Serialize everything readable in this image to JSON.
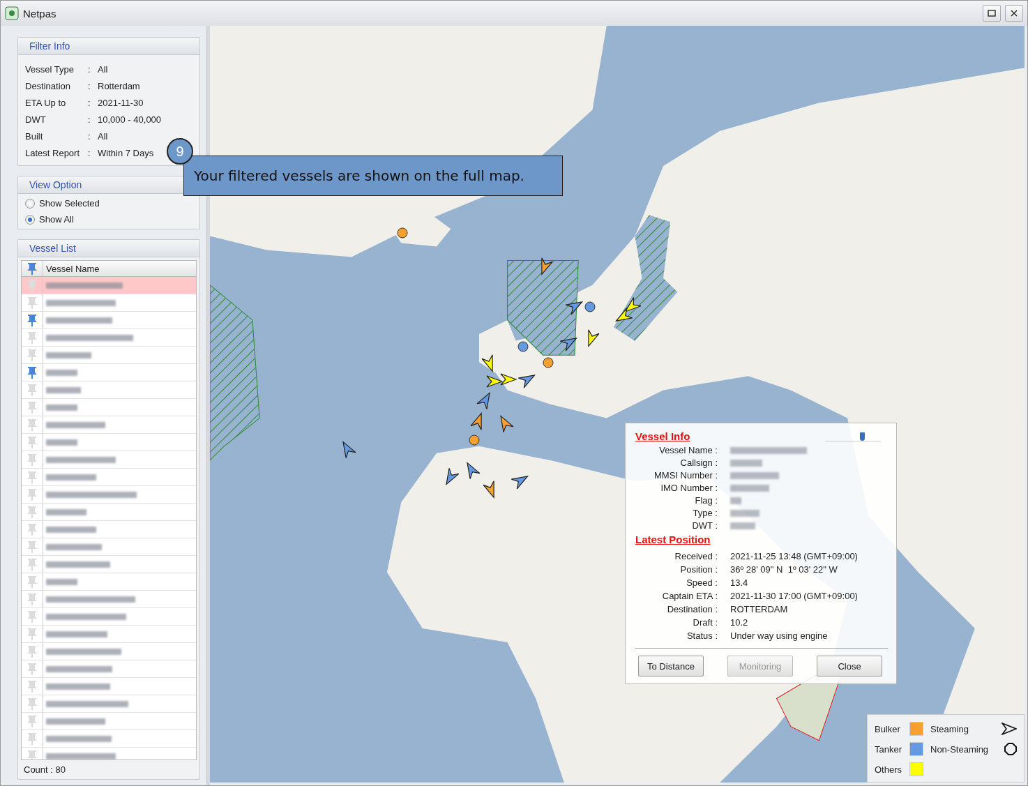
{
  "window": {
    "title": "Netpas"
  },
  "filter_info": {
    "title": "Filter Info",
    "rows": [
      {
        "label": "Vessel Type",
        "separator": ":",
        "value": "All"
      },
      {
        "label": "Destination",
        "separator": ":",
        "value": "Rotterdam"
      },
      {
        "label": "ETA Up to",
        "separator": ":",
        "value": "2021-11-30"
      },
      {
        "label": "DWT",
        "separator": ":",
        "value": "10,000 - 40,000"
      },
      {
        "label": "Built",
        "separator": ":",
        "value": "All"
      },
      {
        "label": "Latest Report",
        "separator": ":",
        "value": "Within 7 Days"
      }
    ]
  },
  "view_option": {
    "title": "View Option",
    "options": [
      {
        "label": "Show Selected",
        "selected": false
      },
      {
        "label": "Show All",
        "selected": true
      }
    ]
  },
  "vessel_list": {
    "title": "Vessel List",
    "column": "Vessel Name",
    "count": "Count : 80",
    "rows": [
      {
        "pinned": false,
        "selected": true
      },
      {
        "pinned": false,
        "selected": false
      },
      {
        "pinned": true,
        "selected": false
      },
      {
        "pinned": false,
        "selected": false
      },
      {
        "pinned": false,
        "selected": false
      },
      {
        "pinned": true,
        "selected": false
      },
      {
        "pinned": false,
        "selected": false
      },
      {
        "pinned": false,
        "selected": false
      },
      {
        "pinned": false,
        "selected": false
      },
      {
        "pinned": false,
        "selected": false
      },
      {
        "pinned": false,
        "selected": false
      },
      {
        "pinned": false,
        "selected": false
      },
      {
        "pinned": false,
        "selected": false
      },
      {
        "pinned": false,
        "selected": false
      },
      {
        "pinned": false,
        "selected": false
      },
      {
        "pinned": false,
        "selected": false
      },
      {
        "pinned": false,
        "selected": false
      },
      {
        "pinned": false,
        "selected": false
      },
      {
        "pinned": false,
        "selected": false
      },
      {
        "pinned": false,
        "selected": false
      },
      {
        "pinned": false,
        "selected": false
      },
      {
        "pinned": false,
        "selected": false
      },
      {
        "pinned": false,
        "selected": false
      },
      {
        "pinned": false,
        "selected": false
      },
      {
        "pinned": false,
        "selected": false
      },
      {
        "pinned": false,
        "selected": false
      },
      {
        "pinned": false,
        "selected": false
      },
      {
        "pinned": false,
        "selected": false
      }
    ]
  },
  "callout": {
    "step": "9",
    "text": "Your filtered vessels are shown on the full map."
  },
  "map": {
    "vessels": [
      {
        "color": "#f5a030",
        "steaming": false
      },
      {
        "color": "#f5a030",
        "steaming": true
      },
      {
        "color": "#6699dd",
        "steaming": false
      },
      {
        "color": "#6699dd",
        "steaming": true
      },
      {
        "color": "#ffff00",
        "steaming": true
      },
      {
        "color": "#ffff00",
        "steaming": true
      },
      {
        "color": "#ffff00",
        "steaming": true
      },
      {
        "color": "#6699dd",
        "steaming": true
      },
      {
        "color": "#6699dd",
        "steaming": false
      },
      {
        "color": "#ffff00",
        "steaming": true
      },
      {
        "color": "#ffff00",
        "steaming": true
      },
      {
        "color": "#ffff00",
        "steaming": true
      },
      {
        "color": "#6699dd",
        "steaming": true
      },
      {
        "color": "#f5a030",
        "steaming": false
      },
      {
        "color": "#6699dd",
        "steaming": true
      },
      {
        "color": "#f5a030",
        "steaming": true
      },
      {
        "color": "#f5a030",
        "steaming": true
      },
      {
        "color": "#f5a030",
        "steaming": false
      },
      {
        "color": "#6699dd",
        "steaming": true
      },
      {
        "color": "#6699dd",
        "steaming": true
      },
      {
        "color": "#6699dd",
        "steaming": true
      },
      {
        "color": "#f5a030",
        "steaming": true
      },
      {
        "color": "#6699dd",
        "steaming": true
      }
    ]
  },
  "vessel_info": {
    "title": "Vessel Info",
    "zoom_slider": {
      "level": 0.66
    },
    "fields": [
      {
        "label": "Vessel Name :",
        "kind": "blurred"
      },
      {
        "label": "Callsign :",
        "kind": "blurred"
      },
      {
        "label": "MMSI Number :",
        "kind": "blurred"
      },
      {
        "label": "IMO Number :",
        "kind": "blurred"
      },
      {
        "label": "Flag :",
        "kind": "blurred"
      },
      {
        "label": "Type :",
        "kind": "blurred"
      },
      {
        "label": "DWT :",
        "kind": "blurred"
      }
    ],
    "position_title": "Latest Position",
    "position": [
      {
        "label": "Received :",
        "value": "2021-11-25 13:48 (GMT+09:00)"
      },
      {
        "label": "Position :",
        "value": "36º 28' 09\" N  1º 03' 22\" W"
      },
      {
        "label": "Speed :",
        "value": "13.4"
      },
      {
        "label": "Captain ETA :",
        "value": "2021-11-30 17:00 (GMT+09:00)"
      },
      {
        "label": "Destination :",
        "value": "ROTTERDAM"
      },
      {
        "label": "Draft :",
        "value": "10.2"
      },
      {
        "label": "Status :",
        "value": "Under way using engine"
      }
    ],
    "buttons": [
      {
        "label": "To Distance",
        "disabled": false
      },
      {
        "label": "Monitoring",
        "disabled": true
      },
      {
        "label": "Close",
        "disabled": false
      }
    ]
  },
  "legend": {
    "types": [
      {
        "label": "Bulker",
        "color": "#f5a030"
      },
      {
        "label": "Tanker",
        "color": "#6699dd"
      },
      {
        "label": "Others",
        "color": "#ffff00"
      }
    ],
    "states": [
      {
        "label": "Steaming",
        "kind": "steaming"
      },
      {
        "label": "Non-Steaming",
        "kind": "stopped"
      }
    ]
  }
}
